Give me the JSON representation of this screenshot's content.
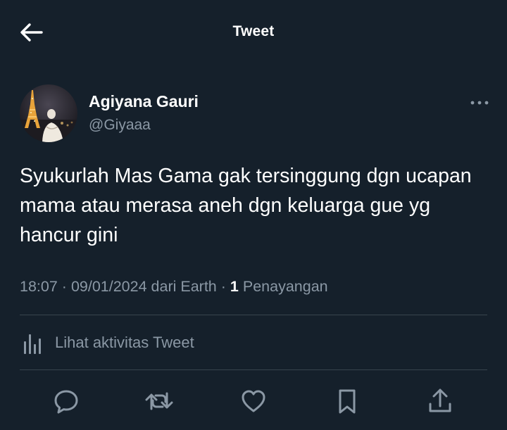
{
  "header": {
    "title": "Tweet",
    "back_icon": "arrow-left-icon"
  },
  "tweet": {
    "author": {
      "name": "Agiyana Gauri",
      "handle": "@Giyaaa",
      "avatar_icon": "profile-photo-eiffel-tower-night"
    },
    "more_icon": "more-options-icon",
    "text": "Syukurlah Mas Gama gak tersinggung dgn ucapan mama atau merasa aneh dgn keluarga gue yg hancur gini",
    "time": "18:07",
    "date": "09/01/2024",
    "source": "dari Earth",
    "views": {
      "count": "1",
      "label": "Penayangan"
    },
    "separator": "·"
  },
  "activity": {
    "label": "Lihat aktivitas Tweet",
    "icon": "analytics-bars-icon"
  },
  "actions": [
    {
      "name": "reply",
      "icon": "reply-icon"
    },
    {
      "name": "retweet",
      "icon": "retweet-icon"
    },
    {
      "name": "like",
      "icon": "heart-icon"
    },
    {
      "name": "bookmark",
      "icon": "bookmark-icon"
    },
    {
      "name": "share",
      "icon": "share-icon"
    }
  ],
  "colors": {
    "background": "#15202b",
    "text_primary": "#ffffff",
    "text_secondary": "#8b98a5",
    "divider": "#38444d"
  }
}
